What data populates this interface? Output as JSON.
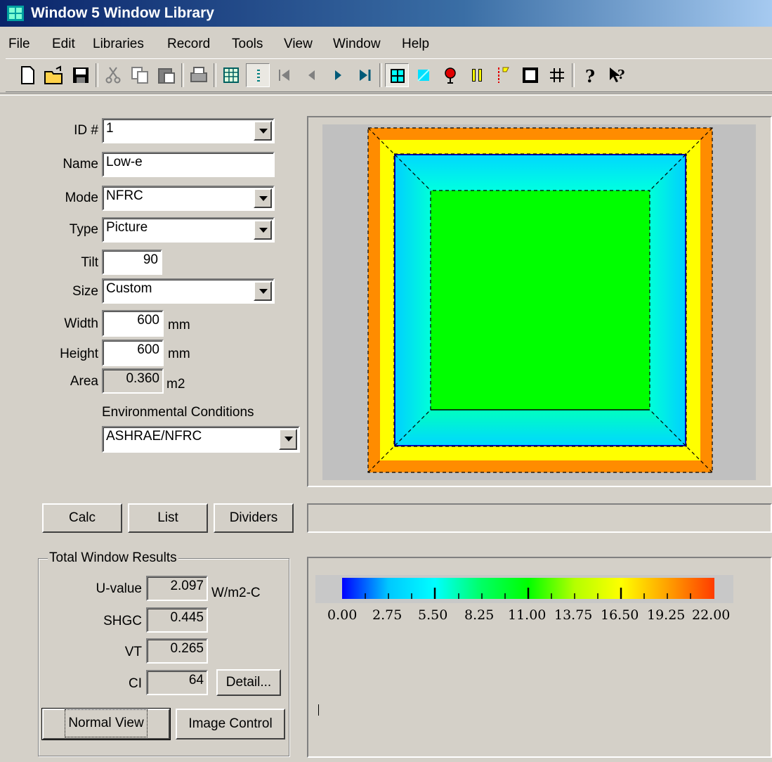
{
  "window": {
    "title": "Window 5 Window Library"
  },
  "menu": [
    "File",
    "Edit",
    "Libraries",
    "Record",
    "Tools",
    "View",
    "Window",
    "Help"
  ],
  "form": {
    "id_label": "ID #",
    "id_value": "1",
    "name_label": "Name",
    "name_value": "Low-e",
    "mode_label": "Mode",
    "mode_value": "NFRC",
    "type_label": "Type",
    "type_value": "Picture",
    "tilt_label": "Tilt",
    "tilt_value": "90",
    "size_label": "Size",
    "size_value": "Custom",
    "width_label": "Width",
    "width_value": "600",
    "width_unit": "mm",
    "height_label": "Height",
    "height_value": "600",
    "height_unit": "mm",
    "area_label": "Area",
    "area_value": "0.360",
    "area_unit": "m2",
    "env_label": "Environmental Conditions",
    "env_value": "ASHRAE/NFRC"
  },
  "actions": {
    "calc": "Calc",
    "list": "List",
    "dividers": "Dividers"
  },
  "results": {
    "title": "Total Window Results",
    "uvalue_label": "U-value",
    "uvalue": "2.097",
    "uvalue_unit": "W/m2-C",
    "shgc_label": "SHGC",
    "shgc": "0.445",
    "vt_label": "VT",
    "vt": "0.265",
    "ci_label": "CI",
    "ci": "64",
    "detail": "Detail..."
  },
  "view_buttons": {
    "normal": "Normal View",
    "image": "Image Control"
  },
  "scale": {
    "labels": [
      "0.00",
      "2.75",
      "5.50",
      "8.25",
      "11.00",
      "13.75",
      "16.50",
      "19.25",
      "22.00"
    ],
    "colors": [
      "#0000ff",
      "#00c8ff",
      "#00ffff",
      "#00ff64",
      "#00ff00",
      "#b4ff00",
      "#ffff00",
      "#ffa000",
      "#ff3c00"
    ]
  },
  "diagram_colors": {
    "frame_outer": "#ff8c00",
    "frame_inner": "#ffff00",
    "edge": "#00e0ff",
    "center": "#00ff00",
    "background": "#c0c0c0"
  },
  "toolbar_icons": [
    "new-icon",
    "open-icon",
    "save-icon",
    "cut-icon",
    "copy-icon",
    "paste-icon",
    "print-icon",
    "grid-view-icon",
    "list-view-icon",
    "first-record-icon",
    "prev-record-icon",
    "next-record-icon",
    "last-record-icon",
    "window-view-icon",
    "glazing-icon",
    "color-icon",
    "divider-icon",
    "temperature-icon",
    "frame-icon",
    "grid-icon",
    "help-icon",
    "context-help-icon"
  ]
}
